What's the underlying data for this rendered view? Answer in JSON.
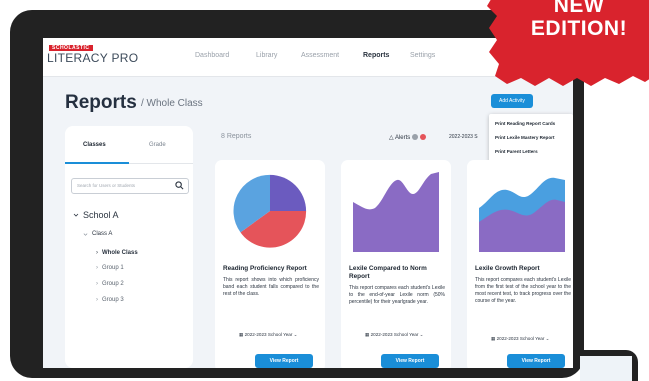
{
  "brand": {
    "publisher": "SCHOLASTIC",
    "product": "LITERACY PRO"
  },
  "nav": {
    "items": [
      "Dashboard",
      "Library",
      "Assessment",
      "Reports",
      "Settings"
    ],
    "active": "Reports"
  },
  "page": {
    "title": "Reports",
    "subtitle": "/ Whole Class"
  },
  "actions": {
    "add_activity": "Add Activity"
  },
  "dropdown": {
    "items": [
      "Print Reading Report Cards",
      "Print Lexile Mastery Report",
      "Print Parent Letters"
    ]
  },
  "sidebar": {
    "tabs": [
      "Classes",
      "Grade"
    ],
    "search_placeholder": "Search for Users or Students",
    "tree": {
      "school": "School A",
      "class": "Class A",
      "items": [
        "Whole Class",
        "Group 1",
        "Group 2",
        "Group 3"
      ]
    }
  },
  "reports": {
    "count_label": "8 Reports",
    "alerts_label": "Alerts",
    "date_filter": "2022-2023 S"
  },
  "cards": [
    {
      "title": "Reading Proficiency Report",
      "description": "This report shows into which proficiency band each student falls compared to the rest of the class.",
      "year": "2022-2023 School Year",
      "button": "View Report"
    },
    {
      "title": "Lexile Compared to Norm Report",
      "description": "This report compares each student's Lexile to the end-of-year Lexile norm (50% percentile) for their yearlgrade year.",
      "year": "2022-2023 School Year",
      "button": "View Report"
    },
    {
      "title": "Lexile Growth Report",
      "description": "This report compares each student's Lexile from the first test of the school year to the most recent test, to track progress over the course of the year.",
      "year": "2022-2023 School Year",
      "button": "View Report"
    }
  ],
  "badge": {
    "line1": "NEW",
    "line2": "EDITION!"
  },
  "colors": {
    "accent": "#1a8ed8",
    "badge_red": "#d9232d",
    "pie_blue": "#5aa3e0",
    "pie_purple": "#6b5bbf",
    "pie_red": "#e5545a",
    "area_purple": "#8a6bc4",
    "area_blue": "#4a9fe0",
    "alert_gray": "#9aa1aa",
    "alert_red": "#e5545a"
  }
}
